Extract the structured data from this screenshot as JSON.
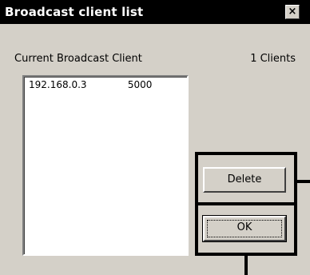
{
  "window": {
    "title": "Broadcast client list",
    "close_glyph": "×"
  },
  "labels": {
    "current_client": "Current Broadcast Client",
    "client_count": "1 Clients"
  },
  "clients": [
    {
      "ip": "192.168.0.3",
      "port": "5000"
    }
  ],
  "buttons": {
    "delete": "Delete",
    "ok": "OK"
  },
  "colors": {
    "dialog_bg": "#d4d0c8",
    "titlebar_bg": "#000000",
    "titlebar_text": "#ffffff",
    "list_bg": "#ffffff",
    "callout": "#000000"
  }
}
